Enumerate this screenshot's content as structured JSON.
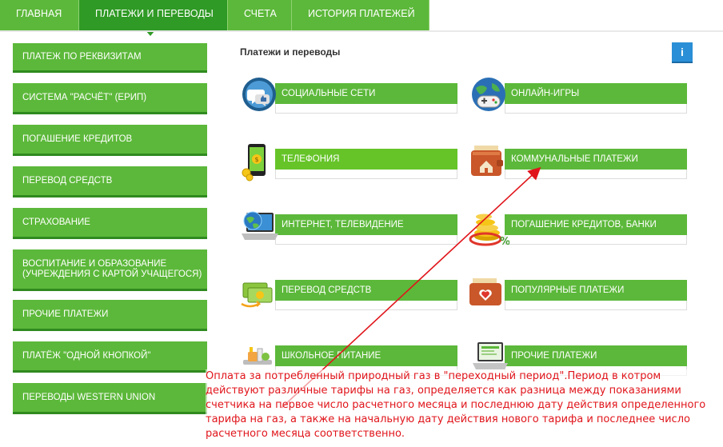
{
  "topnav": {
    "tabs": [
      {
        "label": "ГЛАВНАЯ"
      },
      {
        "label": "ПЛАТЕЖИ И ПЕРЕВОДЫ"
      },
      {
        "label": "СЧЕТА"
      },
      {
        "label": "ИСТОРИЯ ПЛАТЕЖЕЙ"
      }
    ],
    "active_tab": "ПЛАТЕЖИ И ПЕРЕВОДЫ"
  },
  "sidebar": {
    "items": [
      {
        "label": "ПЛАТЕЖ ПО РЕКВИЗИТАМ"
      },
      {
        "label": "СИСТЕМА \"РАСЧЁТ\" (ЕРИП)"
      },
      {
        "label": "ПОГАШЕНИЕ КРЕДИТОВ"
      },
      {
        "label": "ПЕРЕВОД СРЕДСТВ"
      },
      {
        "label": "СТРАХОВАНИЕ"
      },
      {
        "label": "ВОСПИТАНИЕ И ОБРАЗОВАНИЕ (УЧРЕЖДЕНИЯ С КАРТОЙ УЧАЩЕГОСЯ)"
      },
      {
        "label": "ПРОЧИЕ ПЛАТЕЖИ"
      },
      {
        "label": "ПЛАТЁЖ \"ОДНОЙ КНОПКОЙ\""
      },
      {
        "label": "ПЕРЕВОДЫ WESTERN UNION"
      }
    ]
  },
  "main": {
    "title": "Платежи и переводы",
    "info_label": "i",
    "categories": [
      {
        "label": "СОЦИАЛЬНЫЕ СЕТИ",
        "icon": "social-network-icon"
      },
      {
        "label": "ОНЛАЙН-ИГРЫ",
        "icon": "gamepad-globe-icon"
      },
      {
        "label": "ТЕЛЕФОНИЯ",
        "icon": "smartphone-icon"
      },
      {
        "label": "КОММУНАЛЬНЫЕ ПЛАТЕЖИ",
        "icon": "house-wallet-icon"
      },
      {
        "label": "ИНТЕРНЕТ, ТЕЛЕВИДЕНИЕ",
        "icon": "laptop-globe-icon"
      },
      {
        "label": "ПОГАШЕНИЕ КРЕДИТОВ, БАНКИ",
        "icon": "coins-percent-icon"
      },
      {
        "label": "ПЕРЕВОД СРЕДСТВ",
        "icon": "money-transfer-icon"
      },
      {
        "label": "ПОПУЛЯРНЫЕ ПЛАТЕЖИ",
        "icon": "heart-wallet-icon"
      },
      {
        "label": "ШКОЛЬНОЕ ПИТАНИЕ",
        "icon": "school-meal-icon"
      },
      {
        "label": "ПРОЧИЕ ПЛАТЕЖИ",
        "icon": "laptop-icon"
      }
    ]
  },
  "annotation": {
    "text": "Оплата за потребленный природный газ в \"переходный период\".Период в котром действуют различные тарифы на газ, определяется как разница между показаниями счетчика на первое число расчетного месяца и последнюю дату действия определенного тарифа на газ, а также на начальную дату действия нового тарифа и последнее число расчетного месяца соответственно.",
    "color": "#e0151b"
  },
  "colors": {
    "accent": "#5cb83a",
    "accent_dark": "#2f9a25",
    "info": "#2a8fd6"
  }
}
